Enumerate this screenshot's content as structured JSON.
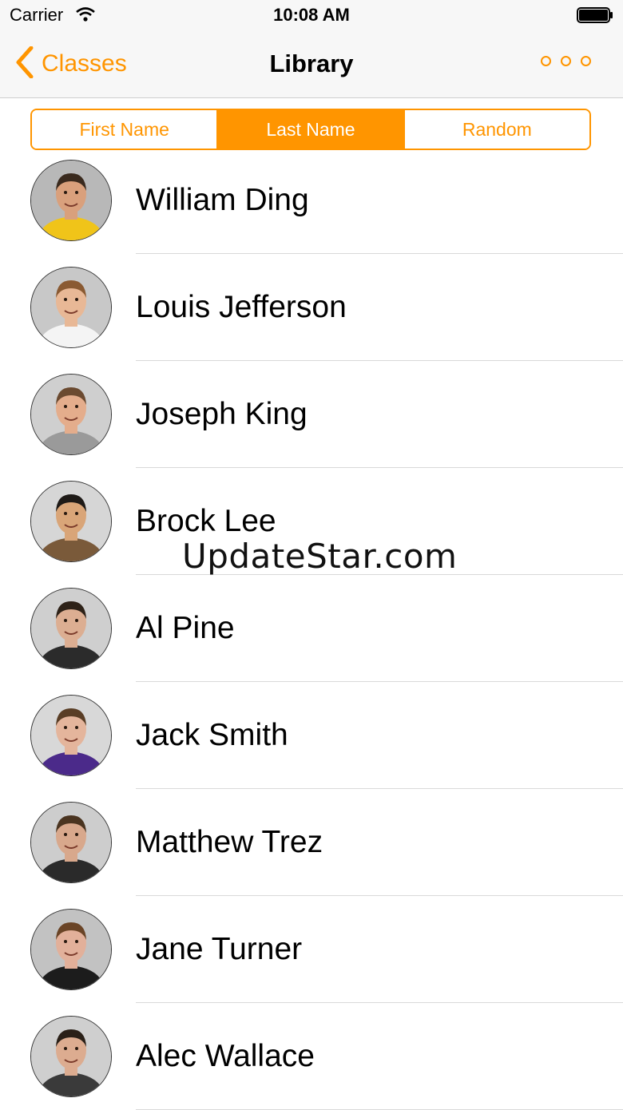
{
  "status_bar": {
    "carrier": "Carrier",
    "time": "10:08 AM",
    "wifi_icon": "wifi-icon",
    "battery_icon": "battery-icon"
  },
  "nav": {
    "back_label": "Classes",
    "back_icon": "chevron-left-icon",
    "title": "Library",
    "more_icon": "more-dots-icon",
    "accent": "#ff9500"
  },
  "segments": [
    {
      "label": "First Name",
      "selected": false
    },
    {
      "label": "Last Name",
      "selected": true
    },
    {
      "label": "Random",
      "selected": false
    }
  ],
  "students": [
    {
      "name": "William Ding",
      "shirt": "#f0c419",
      "skin": "#d9a07c",
      "bg": "#b8b8b8",
      "hair": "#3a2a1e"
    },
    {
      "name": "Louis Jefferson",
      "shirt": "#f4f4f4",
      "skin": "#e8b896",
      "bg": "#c8c8c8",
      "hair": "#8a5a32"
    },
    {
      "name": "Joseph King",
      "shirt": "#9a9a9a",
      "skin": "#e4ad8c",
      "bg": "#cfcfcf",
      "hair": "#6b4a30"
    },
    {
      "name": "Brock Lee",
      "shirt": "#7a5a3a",
      "skin": "#d9a578",
      "bg": "#d6d6d6",
      "hair": "#1e1a17"
    },
    {
      "name": "Al Pine",
      "shirt": "#2b2b2b",
      "skin": "#dcae92",
      "bg": "#cfcfcf",
      "hair": "#2e2218"
    },
    {
      "name": "Jack Smith",
      "shirt": "#4b2a8a",
      "skin": "#e4b59c",
      "bg": "#d8d8d8",
      "hair": "#5a3e26"
    },
    {
      "name": "Matthew Trez",
      "shirt": "#2a2a2a",
      "skin": "#d8a88c",
      "bg": "#cdcdcd",
      "hair": "#4a3420"
    },
    {
      "name": "Jane Turner",
      "shirt": "#1c1c1c",
      "skin": "#e2b09a",
      "bg": "#c2c2c2",
      "hair": "#6a4426"
    },
    {
      "name": "Alec Wallace",
      "shirt": "#3a3a3a",
      "skin": "#dcac90",
      "bg": "#cfcfcf",
      "hair": "#2a2018"
    }
  ],
  "watermark": "UpdateStar.com"
}
